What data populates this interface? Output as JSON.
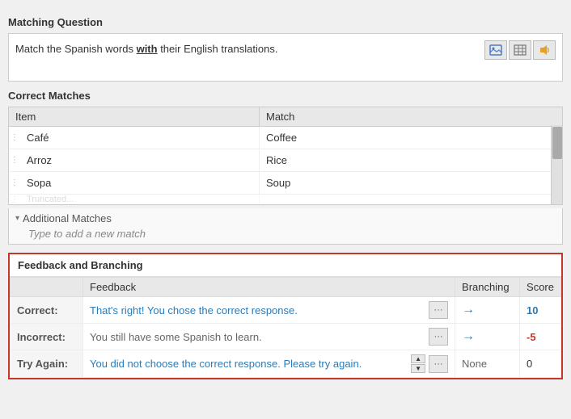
{
  "sections": {
    "matching_question": {
      "title": "Matching Question",
      "question_text_pre": "Match the Spanish words ",
      "question_text_bold": "with",
      "question_text_post": " their English translations.",
      "icons": [
        {
          "name": "image-icon",
          "symbol": "🖼"
        },
        {
          "name": "table-icon",
          "symbol": "▦"
        },
        {
          "name": "audio-icon",
          "symbol": "🔊"
        }
      ]
    },
    "correct_matches": {
      "title": "Correct Matches",
      "columns": {
        "item": "Item",
        "match": "Match"
      },
      "rows": [
        {
          "item": "Café",
          "match": "Coffee"
        },
        {
          "item": "Arroz",
          "match": "Rice"
        },
        {
          "item": "Sopa",
          "match": "Soup"
        }
      ]
    },
    "additional_matches": {
      "label": "Additional Matches",
      "hint": "Type to add a new match"
    },
    "feedback_branching": {
      "title": "Feedback and Branching",
      "columns": {
        "feedback": "Feedback",
        "branching": "Branching",
        "score": "Score"
      },
      "rows": [
        {
          "label": "Correct:",
          "feedback_text": "That's right! You chose the correct response.",
          "branching": "→",
          "score": "10",
          "score_type": "positive"
        },
        {
          "label": "Incorrect:",
          "feedback_text": "You still have some Spanish to learn.",
          "branching": "→",
          "score": "-5",
          "score_type": "negative"
        },
        {
          "label": "Try Again:",
          "feedback_text": "You did not choose the correct response. Please try again.",
          "branching": "None",
          "score": "0",
          "score_type": "neutral"
        }
      ]
    }
  }
}
